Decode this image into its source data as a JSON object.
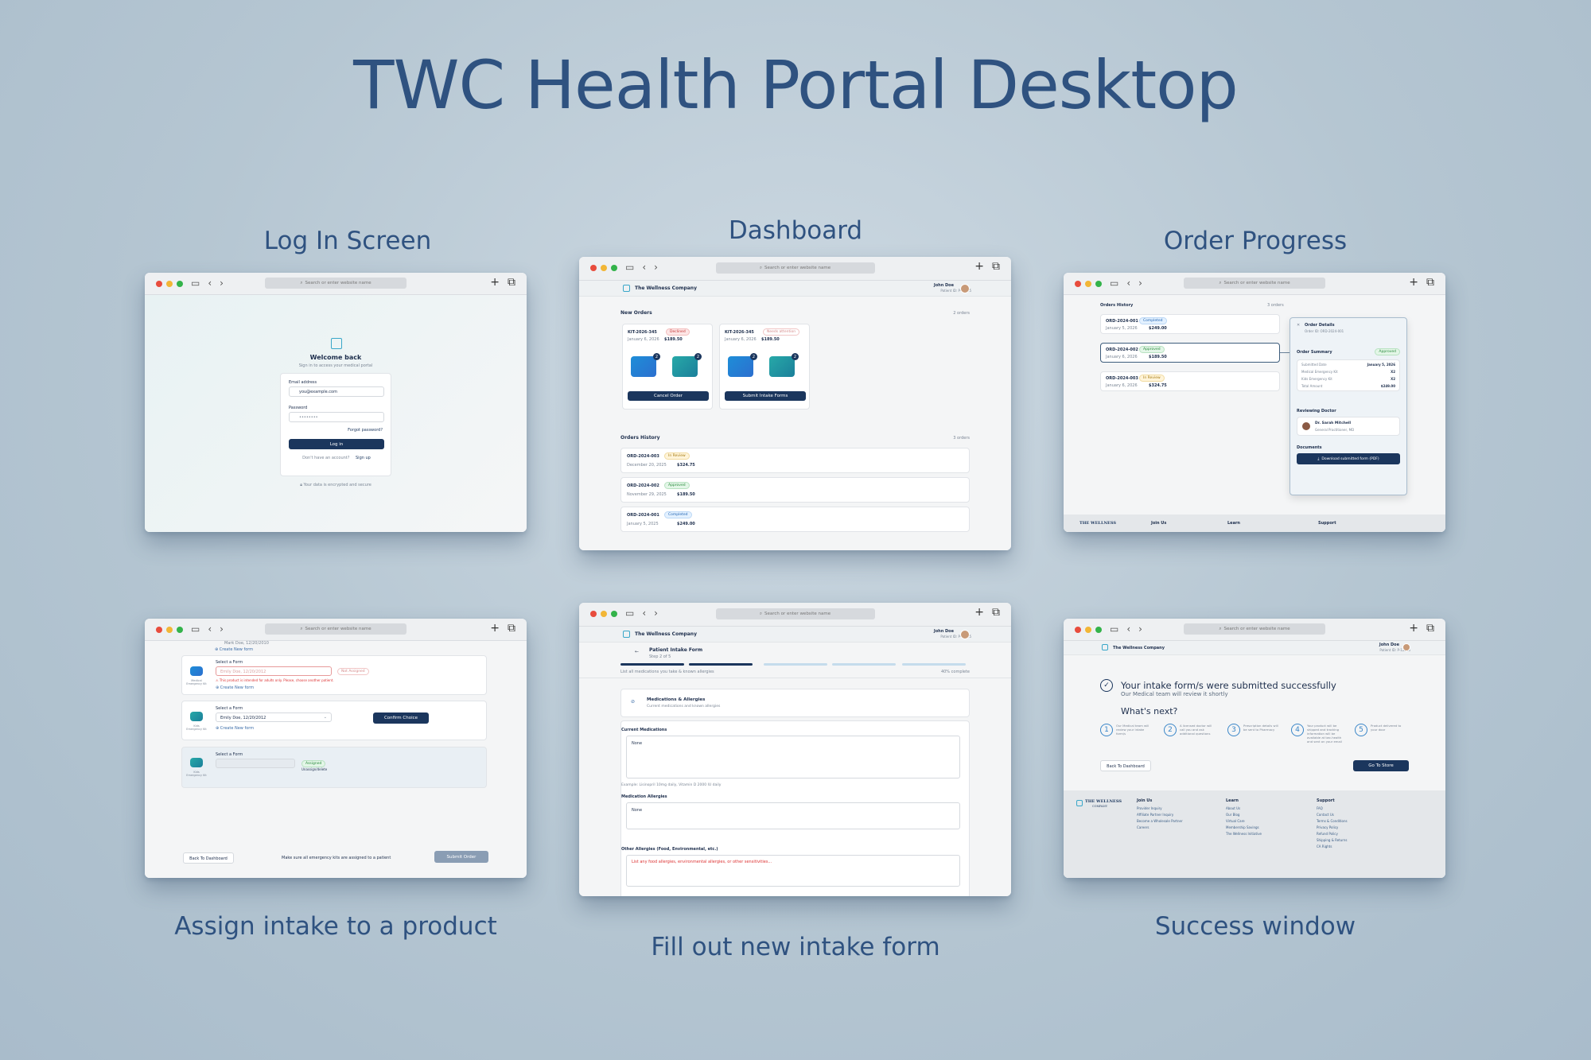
{
  "title": "TWC Health Portal Desktop",
  "captions": {
    "login": "Log In Screen",
    "dashboard": "Dashboard",
    "order_progress": "Order Progress",
    "assign": "Assign intake to a product",
    "intake": "Fill out new intake form",
    "success": "Success window"
  },
  "browser": {
    "address": "Search or enter website name"
  },
  "brand": {
    "name": "The Wellness Company",
    "footer_logo": "THE WELLNESS",
    "footer_sub": "COMPANY"
  },
  "user": {
    "name": "John Doe",
    "patient_id": "Patient ID: P-12345"
  },
  "login": {
    "heading": "Welcome back",
    "sub": "Sign in to access your medical portal",
    "email_label": "Email address",
    "email_value": "you@example.com",
    "password_label": "Password",
    "password_value": "••••••••",
    "forgot": "Forgot password?",
    "button": "Log in",
    "no_account": "Don't have an account?",
    "signup": "Sign up",
    "secure": "Your data is encrypted and secure"
  },
  "dashboard": {
    "new_orders": "New Orders",
    "new_orders_count": "2 orders",
    "orders": [
      {
        "id": "KIT-2026-345",
        "status": "Declined",
        "date": "January 6, 2026",
        "price": "$189.50",
        "button": "Cancel Order"
      },
      {
        "id": "KIT-2026-345",
        "status": "Needs attention",
        "date": "January 6, 2026",
        "price": "$189.50",
        "button": "Submit Intake Forms"
      }
    ],
    "history_title": "Orders History",
    "history_count": "3 orders",
    "history": [
      {
        "id": "ORD-2024-003",
        "status": "In Review",
        "date": "December 20, 2025",
        "price": "$324.75"
      },
      {
        "id": "ORD-2024-002",
        "status": "Approved",
        "date": "November 29, 2025",
        "price": "$189.50"
      },
      {
        "id": "ORD-2024-001",
        "status": "Completed",
        "date": "January 5, 2025",
        "price": "$249.00"
      }
    ]
  },
  "order_progress": {
    "history_title": "Orders History",
    "history_count": "3 orders",
    "orders": [
      {
        "id": "ORD-2024-001",
        "status": "Completed",
        "date": "January 5, 2026",
        "price": "$249.00"
      },
      {
        "id": "ORD-2024-002",
        "status": "Approved",
        "date": "January 6, 2026",
        "price": "$189.50"
      },
      {
        "id": "ORD-2024-003",
        "status": "In Review",
        "date": "January 6, 2026",
        "price": "$324.75"
      }
    ],
    "details_title": "Order Details",
    "details_order": "Order ID: ORD-2024-001",
    "summary_title": "Order Summary",
    "summary_status": "Approved",
    "summary_rows": [
      {
        "label": "Submitted Date",
        "value": "January 5, 2026"
      },
      {
        "label": "Medical Emergency Kit",
        "value": "X2"
      },
      {
        "label": "Kids Emergency Kit",
        "value": "X2"
      },
      {
        "label": "Total Amount",
        "value": "$249.00"
      }
    ],
    "doctor_title": "Reviewing Doctor",
    "doctor_name": "Dr. Sarah Mitchell",
    "doctor_role": "General Practitioner, MD",
    "documents_title": "Documents",
    "download_btn": "Download submitted form (PDF)",
    "footer_cols": [
      "Join Us",
      "Learn",
      "Support"
    ]
  },
  "assign": {
    "top_value": "Mark Doe, 12/20/2010",
    "create_new": "Create New form",
    "rows": [
      {
        "kit": "Medical Emergency Kit",
        "label": "Select a Form",
        "value": "Emily Doe, 12/20/2012",
        "status": "Not Assigned",
        "error": "This product is intended for adults only. Please, choose another patient."
      },
      {
        "kit": "Kids Emergency Kit",
        "label": "Select a Form",
        "value": "Emily Doe, 12/20/2012",
        "button": "Confirm Choice"
      },
      {
        "kit": "Kids Emergency Kit",
        "label": "Select a Form",
        "value": "",
        "status": "Assigned",
        "link": "Unassign/delete"
      }
    ],
    "back": "Back To Dashboard",
    "note": "Make sure all emergency kits are assigned to a patient",
    "submit": "Submit Order"
  },
  "intake": {
    "title": "Patient Intake Form",
    "step": "Step 2 of 5",
    "hint": "List all medications you take & known allergies",
    "percent": "40% complete",
    "section_title": "Medications & Allergies",
    "section_sub": "Current medications and known allergies",
    "current_meds_label": "Current Medications",
    "current_meds_value": "None",
    "example": "Example: Lisinopril 10mg daily, Vitamin D 2000 IU daily",
    "med_allergies_label": "Medication Allergies",
    "med_allergies_value": "None",
    "other_label": "Other Allergies (Food, Environmental, etc.)",
    "other_placeholder": "List any food allergies, environmental allergies, or other sensitivities..."
  },
  "success": {
    "heading": "Your intake form/s were submitted successfully",
    "sub": "Our Medical team will review it shortly",
    "next": "What's next?",
    "steps": [
      {
        "n": "1",
        "text": "Our Medical team will review your intake form/s"
      },
      {
        "n": "2",
        "text": "A licensed doctor will call you and ask additional questions"
      },
      {
        "n": "3",
        "text": "Prescription details will be sent to Pharmacy"
      },
      {
        "n": "4",
        "text": "Your product will be shipped and tracking information will be available at twc.health and sent on your email"
      },
      {
        "n": "5",
        "text": "Product delivered to your door"
      }
    ],
    "back": "Back To Dashboard",
    "store": "Go To Store",
    "footer": {
      "join": {
        "title": "Join Us",
        "links": [
          "Provider Inquiry",
          "Affiliate Partner Inquiry",
          "Become a Wholesale Partner",
          "Careers"
        ]
      },
      "learn": {
        "title": "Learn",
        "links": [
          "About Us",
          "Our Blog",
          "Virtual Care",
          "Membership Savings",
          "The Wellness Initiative"
        ]
      },
      "support": {
        "title": "Support",
        "links": [
          "FAQ",
          "Contact Us",
          "Terms & Conditions",
          "Privacy Policy",
          "Refund Policy",
          "Shipping & Returns",
          "CA Rights"
        ]
      }
    }
  }
}
